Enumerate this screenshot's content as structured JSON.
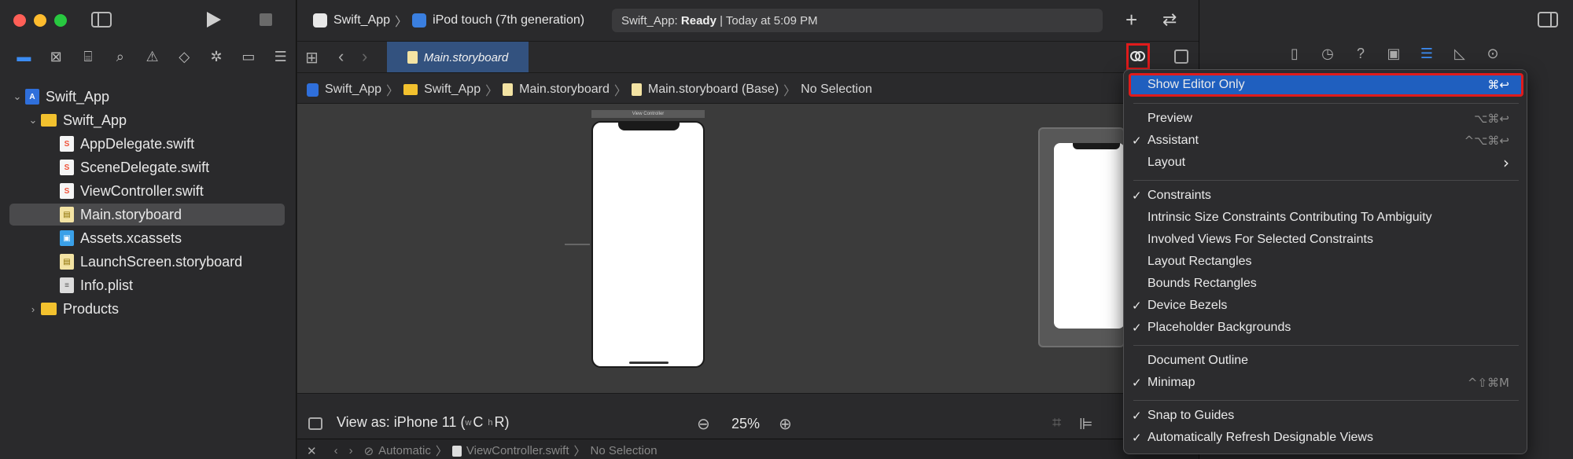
{
  "project": {
    "scheme": "Swift_App",
    "device": "iPod touch (7th generation)",
    "status_app": "Swift_App:",
    "status_state": "Ready",
    "status_time": "| Today at 5:09 PM"
  },
  "tree": {
    "root": "Swift_App",
    "group": "Swift_App",
    "files": [
      "AppDelegate.swift",
      "SceneDelegate.swift",
      "ViewController.swift",
      "Main.storyboard",
      "Assets.xcassets",
      "LaunchScreen.storyboard",
      "Info.plist"
    ],
    "products": "Products"
  },
  "tab": {
    "label": "Main.storyboard"
  },
  "jumpbar": {
    "items": [
      "Swift_App",
      "Swift_App",
      "Main.storyboard",
      "Main.storyboard (Base)",
      "No Selection"
    ]
  },
  "canvas": {
    "scene_title": "View Controller"
  },
  "bottom": {
    "view_as": "View as: iPhone 11 (",
    "w": "w",
    "c": "C",
    "h": "h",
    "r": "R)",
    "zoom": "25%"
  },
  "debug": {
    "automatic": "Automatic",
    "file": "ViewController.swift",
    "selection": "No Selection"
  },
  "menu": {
    "items": [
      {
        "label": "Show Editor Only",
        "shortcut": "⌘↩",
        "checked": false,
        "highlighted": true
      },
      {
        "label": "Preview",
        "shortcut": "⌥⌘↩",
        "checked": false
      },
      {
        "label": "Assistant",
        "shortcut": "^⌥⌘↩",
        "checked": true
      },
      {
        "label": "Layout",
        "shortcut": "›",
        "checked": false
      },
      {
        "label": "Constraints",
        "shortcut": "",
        "checked": true
      },
      {
        "label": "Intrinsic Size Constraints Contributing To Ambiguity",
        "shortcut": "",
        "checked": false
      },
      {
        "label": "Involved Views For Selected Constraints",
        "shortcut": "",
        "checked": false
      },
      {
        "label": "Layout Rectangles",
        "shortcut": "",
        "checked": false
      },
      {
        "label": "Bounds Rectangles",
        "shortcut": "",
        "checked": false
      },
      {
        "label": "Device Bezels",
        "shortcut": "",
        "checked": true
      },
      {
        "label": "Placeholder Backgrounds",
        "shortcut": "",
        "checked": true
      },
      {
        "label": "Document Outline",
        "shortcut": "",
        "checked": false
      },
      {
        "label": "Minimap",
        "shortcut": "^⇧⌘M",
        "checked": true
      },
      {
        "label": "Snap to Guides",
        "shortcut": "",
        "checked": true
      },
      {
        "label": "Automatically Refresh Designable Views",
        "shortcut": "",
        "checked": true
      }
    ],
    "checkmark": "✓"
  },
  "colors": {
    "highlight": "#1f5fbf",
    "annotation": "#e01b1b",
    "accent": "#3b8cf3"
  }
}
